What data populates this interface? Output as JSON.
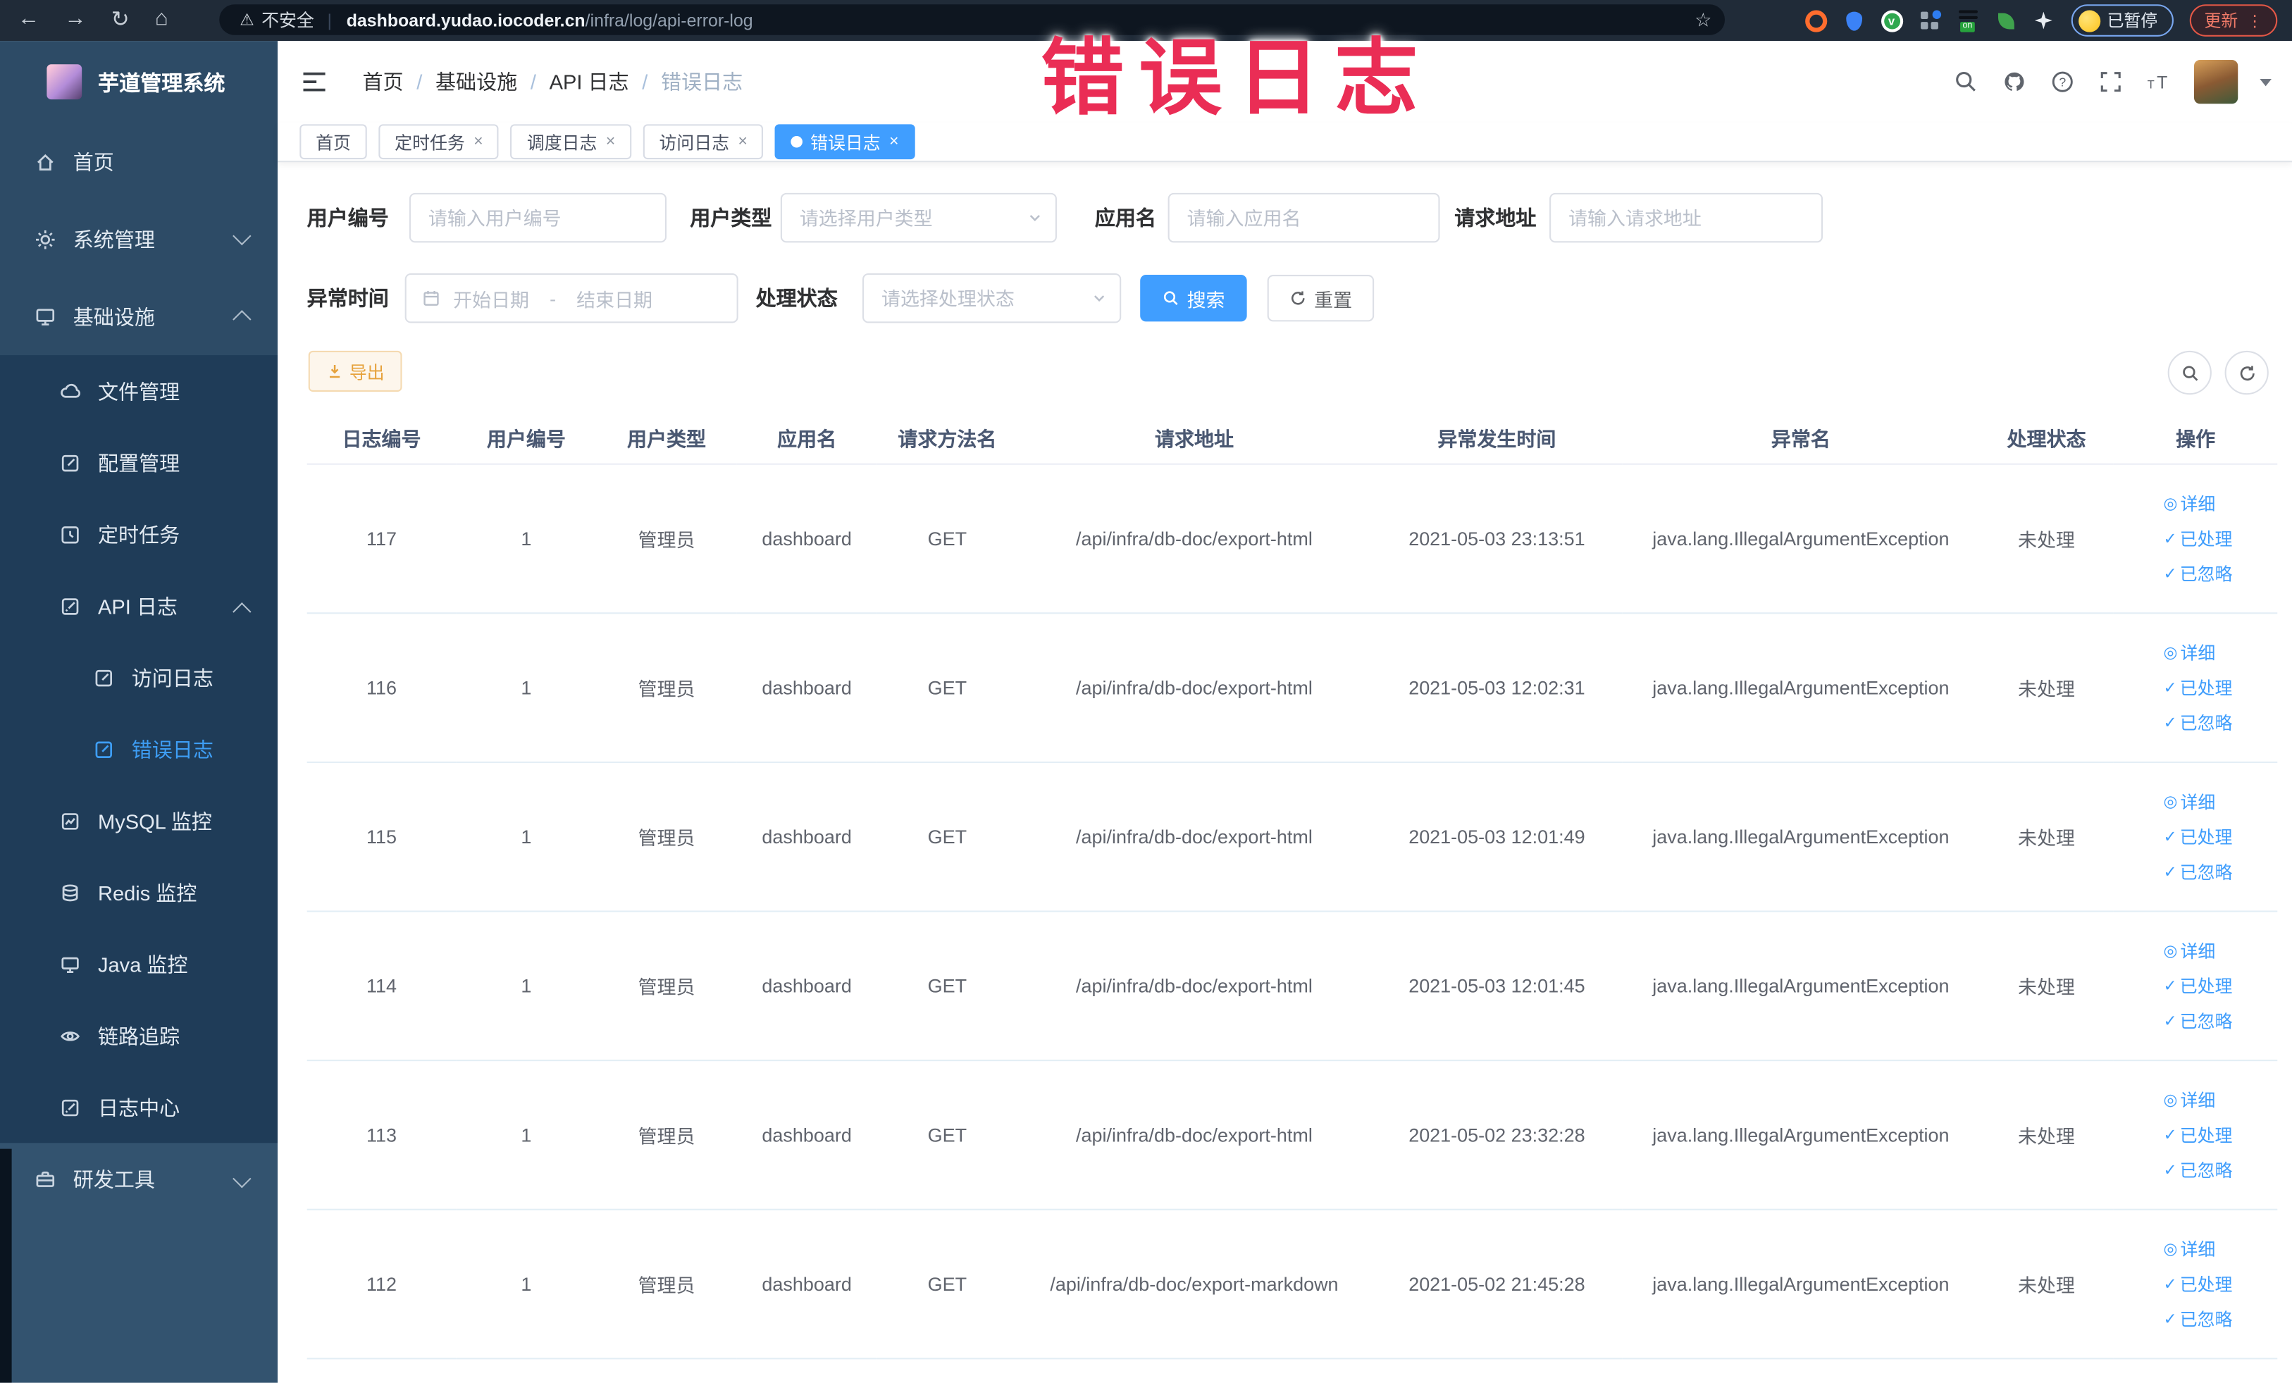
{
  "icons": {
    "back": "←",
    "forward": "→",
    "reload": "↻",
    "home": "⌂",
    "warning": "⚠",
    "star": "☆",
    "kebab": "⋮",
    "divider": "|",
    "ext_v": "v",
    "ext_on": "on"
  },
  "browser": {
    "security_label": "不安全",
    "url_host": "dashboard.yudao.iocoder.cn",
    "url_path": "/infra/log/api-error-log",
    "paused_label": "已暂停",
    "update_label": "更新"
  },
  "overlay": {
    "annotation": "错误日志"
  },
  "sidebar": {
    "title": "芋道管理系统",
    "items": [
      {
        "label": "首页"
      },
      {
        "label": "系统管理"
      },
      {
        "label": "基础设施"
      },
      {
        "label": "文件管理"
      },
      {
        "label": "配置管理"
      },
      {
        "label": "定时任务"
      },
      {
        "label": "API 日志"
      },
      {
        "label": "访问日志"
      },
      {
        "label": "错误日志"
      },
      {
        "label": "MySQL 监控"
      },
      {
        "label": "Redis 监控"
      },
      {
        "label": "Java 监控"
      },
      {
        "label": "链路追踪"
      },
      {
        "label": "日志中心"
      },
      {
        "label": "研发工具"
      }
    ]
  },
  "header": {
    "breadcrumb": {
      "items": [
        "首页",
        "基础设施",
        "API 日志",
        "错误日志"
      ],
      "separator": "/"
    }
  },
  "tabs": {
    "close_glyph": "×",
    "items": [
      {
        "label": "首页"
      },
      {
        "label": "定时任务"
      },
      {
        "label": "调度日志"
      },
      {
        "label": "访问日志"
      },
      {
        "label": "错误日志"
      }
    ]
  },
  "filters": {
    "user_id": {
      "label": "用户编号",
      "placeholder": "请输入用户编号",
      "value": ""
    },
    "user_type": {
      "label": "用户类型",
      "placeholder": "请选择用户类型",
      "value": ""
    },
    "app_name": {
      "label": "应用名",
      "placeholder": "请输入应用名",
      "value": ""
    },
    "request_url": {
      "label": "请求地址",
      "placeholder": "请输入请求地址",
      "value": ""
    },
    "exception_time": {
      "label": "异常时间",
      "start_placeholder": "开始日期",
      "range_separator": "-",
      "end_placeholder": "结束日期"
    },
    "process_status": {
      "label": "处理状态",
      "placeholder": "请选择处理状态",
      "value": ""
    },
    "search_label": "搜索",
    "reset_label": "重置"
  },
  "toolbar": {
    "export_label": "导出"
  },
  "table": {
    "columns": [
      "日志编号",
      "用户编号",
      "用户类型",
      "应用名",
      "请求方法名",
      "请求地址",
      "异常发生时间",
      "异常名",
      "处理状态",
      "操作"
    ],
    "actions": [
      {
        "icon": "◎",
        "label": "详细"
      },
      {
        "icon": "✓",
        "label": "已处理"
      },
      {
        "icon": "✓",
        "label": "已忽略"
      }
    ],
    "rows": [
      {
        "id": "117",
        "user_id": "1",
        "user_type": "管理员",
        "app": "dashboard",
        "method": "GET",
        "url": "/api/infra/db-doc/export-html",
        "time": "2021-05-03 23:13:51",
        "exception": "java.lang.IllegalArgumentException",
        "status": "未处理"
      },
      {
        "id": "116",
        "user_id": "1",
        "user_type": "管理员",
        "app": "dashboard",
        "method": "GET",
        "url": "/api/infra/db-doc/export-html",
        "time": "2021-05-03 12:02:31",
        "exception": "java.lang.IllegalArgumentException",
        "status": "未处理"
      },
      {
        "id": "115",
        "user_id": "1",
        "user_type": "管理员",
        "app": "dashboard",
        "method": "GET",
        "url": "/api/infra/db-doc/export-html",
        "time": "2021-05-03 12:01:49",
        "exception": "java.lang.IllegalArgumentException",
        "status": "未处理"
      },
      {
        "id": "114",
        "user_id": "1",
        "user_type": "管理员",
        "app": "dashboard",
        "method": "GET",
        "url": "/api/infra/db-doc/export-html",
        "time": "2021-05-03 12:01:45",
        "exception": "java.lang.IllegalArgumentException",
        "status": "未处理"
      },
      {
        "id": "113",
        "user_id": "1",
        "user_type": "管理员",
        "app": "dashboard",
        "method": "GET",
        "url": "/api/infra/db-doc/export-html",
        "time": "2021-05-02 23:32:28",
        "exception": "java.lang.IllegalArgumentException",
        "status": "未处理"
      },
      {
        "id": "112",
        "user_id": "1",
        "user_type": "管理员",
        "app": "dashboard",
        "method": "GET",
        "url": "/api/infra/db-doc/export-markdown",
        "time": "2021-05-02 21:45:28",
        "exception": "java.lang.IllegalArgumentException",
        "status": "未处理"
      }
    ]
  }
}
